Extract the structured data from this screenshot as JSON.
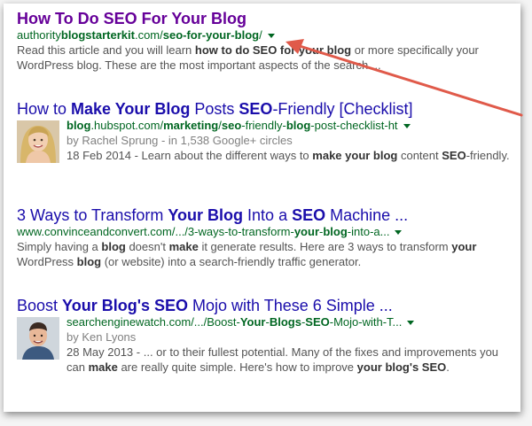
{
  "results": [
    {
      "title": "How To Do SEO For Your Blog",
      "url_parts": [
        "authority",
        "blogstarterkit",
        ".com/",
        "seo-for-your-blog",
        "/"
      ],
      "snippet_parts": [
        "Read this article and you will learn ",
        "how to do SEO for your blog",
        " or more specifically your WordPress blog. These are the most important aspects of the search ..."
      ]
    },
    {
      "title_parts": [
        "How to ",
        "Make Your Blog",
        " Posts ",
        "SEO",
        "-Friendly [Checklist]"
      ],
      "url_parts": [
        "blog",
        ".hubspot.com/",
        "marketing",
        "/",
        "seo",
        "-friendly-",
        "blog",
        "-post-checklist-ht"
      ],
      "author_line": "by Rachel Sprung - in 1,538 Google+ circles",
      "snippet_parts": [
        "18 Feb 2014 - Learn about the different ways to ",
        "make your blog",
        " content ",
        "SEO",
        "-friendly."
      ]
    },
    {
      "title_parts": [
        "3 Ways to Transform ",
        "Your Blog",
        " Into a ",
        "SEO",
        " Machine ..."
      ],
      "url_parts": [
        "www.convinceandconvert.com/.../3-ways-to-transform-",
        "your",
        "-",
        "blog",
        "-into-a..."
      ],
      "snippet_parts": [
        "Simply having a ",
        "blog",
        " doesn't ",
        "make",
        " it generate results. Here are 3 ways to transform ",
        "your",
        " WordPress ",
        "blog",
        " (or website) into a search-friendly traffic generator."
      ]
    },
    {
      "title_parts": [
        "Boost ",
        "Your Blog's SEO",
        " Mojo with These 6 Simple ..."
      ],
      "url_parts": [
        "searchenginewatch.com/.../Boost-",
        "Your",
        "-",
        "Blogs",
        "-",
        "SEO",
        "-Mojo-with-T..."
      ],
      "author_line": "by Ken Lyons",
      "snippet_parts": [
        "28 May 2013 - ... or to their fullest potential. Many of the fixes and improvements you can ",
        "make",
        " are really quite simple. Here's how to improve ",
        "your blog's SEO",
        "."
      ]
    }
  ],
  "colors": {
    "visited": "#660099",
    "link": "#1a0dab",
    "url": "#006621",
    "arrow": "#e05a4a"
  },
  "icons": {
    "dropdown": "caret-down-icon",
    "annotation": "arrow-annotation"
  }
}
